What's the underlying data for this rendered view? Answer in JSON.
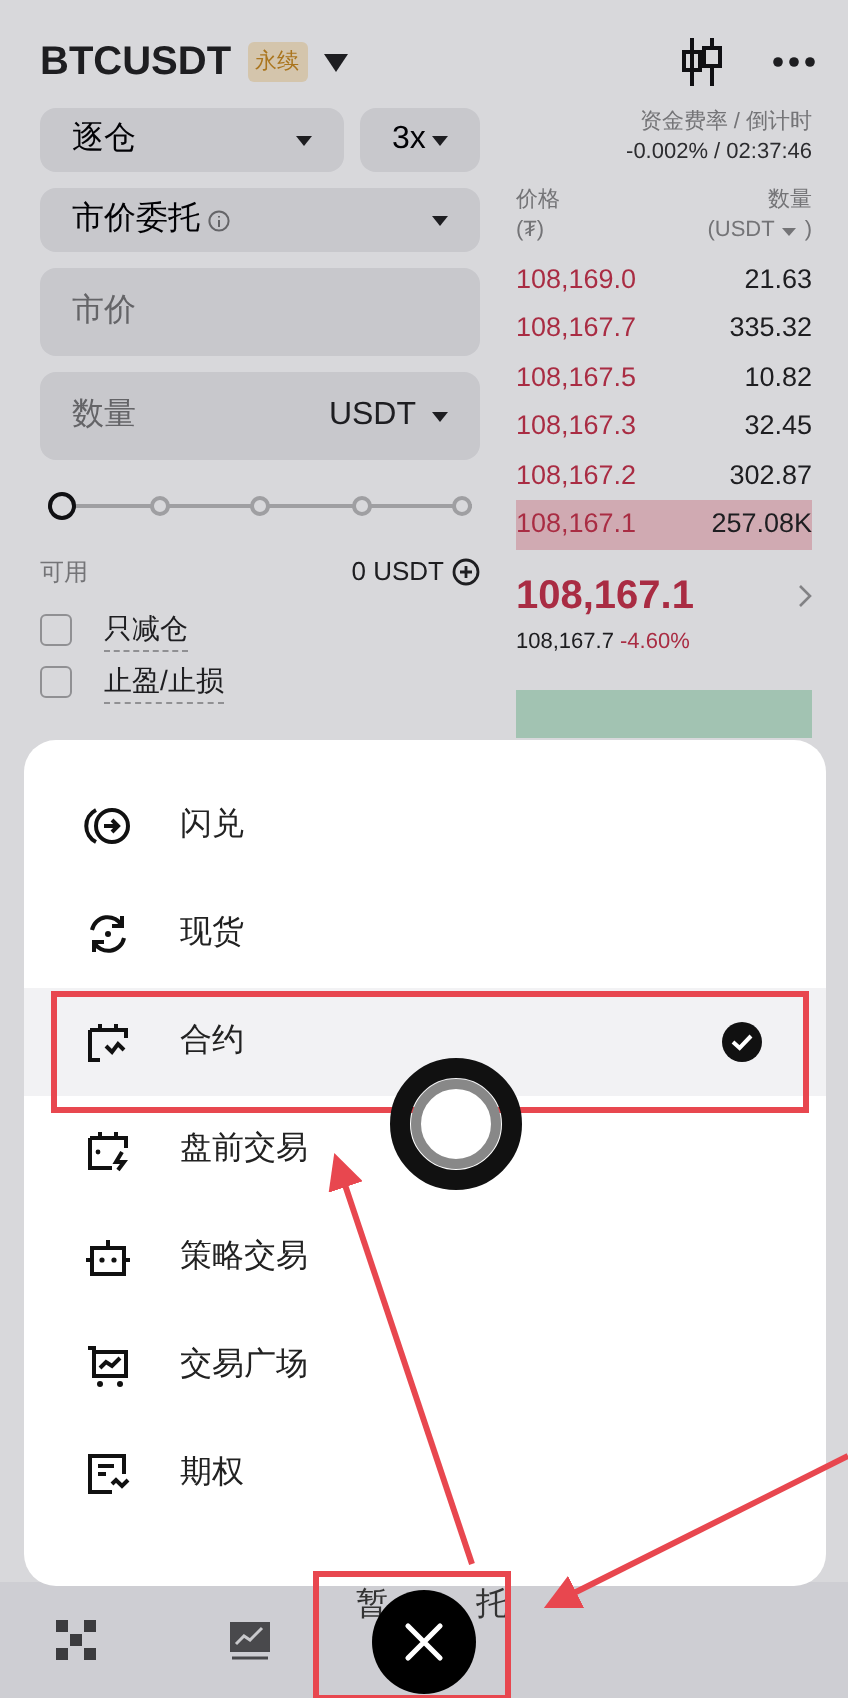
{
  "header": {
    "symbol": "BTCUSDT",
    "tag": "永续"
  },
  "margin_mode": "逐仓",
  "leverage": "3x",
  "order_type": "市价委托",
  "price_field": {
    "placeholder": "市价"
  },
  "amount_field": {
    "placeholder": "数量",
    "unit": "USDT"
  },
  "slider": {
    "level": 0
  },
  "available": {
    "label": "可用",
    "value": "0 USDT"
  },
  "options": [
    {
      "label": "只减仓",
      "checked": false
    },
    {
      "label": "止盈/止损",
      "checked": false
    }
  ],
  "funding": {
    "label": "资金费率 / 倒计时",
    "value": "-0.002% / 02:37:46"
  },
  "order_book": {
    "price_title": "价格",
    "price_unit": "(₮)",
    "amount_title": "数量",
    "amount_unit": "(USDT",
    "amount_unit_end": ")",
    "asks": [
      {
        "price": "108,169.0",
        "amount": "21.63",
        "highlighted": false
      },
      {
        "price": "108,167.7",
        "amount": "335.32",
        "highlighted": false
      },
      {
        "price": "108,167.5",
        "amount": "10.82",
        "highlighted": false
      },
      {
        "price": "108,167.3",
        "amount": "32.45",
        "highlighted": false
      },
      {
        "price": "108,167.2",
        "amount": "302.87",
        "highlighted": false
      },
      {
        "price": "108,167.1",
        "amount": "257.08K",
        "highlighted": true
      }
    ],
    "last_price": "108,167.1",
    "mark_price": "108,167.7",
    "change": "-4.60%"
  },
  "menu": [
    {
      "label": "闪兑",
      "selected": false
    },
    {
      "label": "现货",
      "selected": false
    },
    {
      "label": "合约",
      "selected": true
    },
    {
      "label": "盘前交易",
      "selected": false
    },
    {
      "label": "策略交易",
      "selected": false
    },
    {
      "label": "交易广场",
      "selected": false
    },
    {
      "label": "期权",
      "selected": false
    }
  ],
  "bottom_text": [
    "暂",
    "托"
  ]
}
